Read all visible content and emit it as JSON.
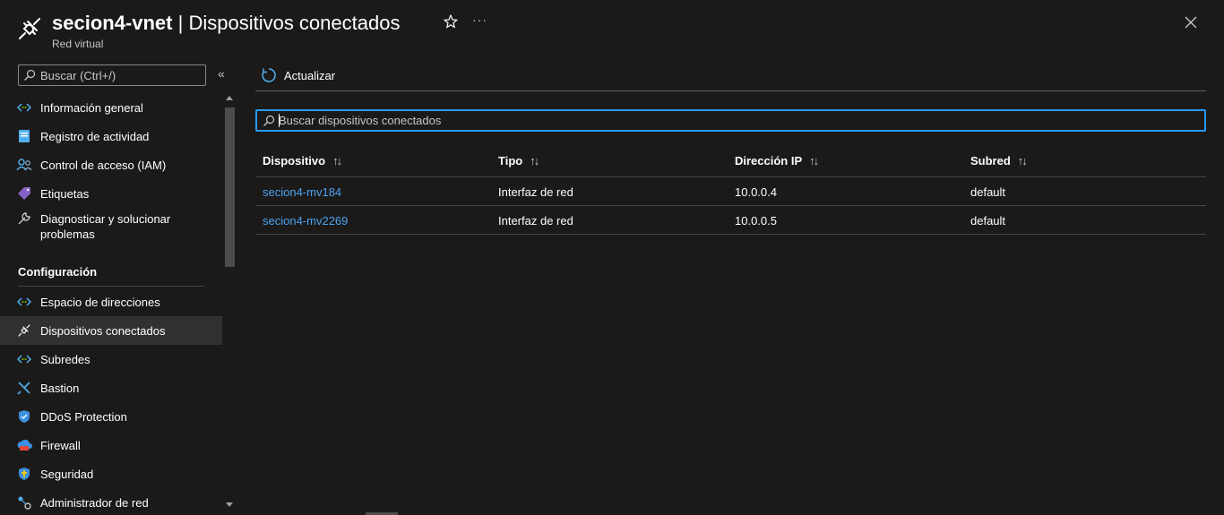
{
  "header": {
    "resource_name": "secion4-vnet",
    "separator": " | ",
    "page_title": "Dispositivos conectados",
    "subtitle": "Red virtual",
    "more_label": "···"
  },
  "sidebar": {
    "search_placeholder": "Buscar (Ctrl+/)",
    "collapse_label": "«",
    "items_top": [
      {
        "label": "Información general",
        "icon": "network-icon"
      },
      {
        "label": "Registro de actividad",
        "icon": "activity-log-icon"
      },
      {
        "label": "Control de acceso (IAM)",
        "icon": "iam-icon"
      },
      {
        "label": "Etiquetas",
        "icon": "tag-icon"
      },
      {
        "label": "Diagnosticar y solucionar problemas",
        "icon": "wrench-icon"
      }
    ],
    "section_configuracion": "Configuración",
    "items_config": [
      {
        "label": "Espacio de direcciones",
        "icon": "network-icon"
      },
      {
        "label": "Dispositivos conectados",
        "icon": "plug-icon",
        "active": true
      },
      {
        "label": "Subredes",
        "icon": "network-icon"
      },
      {
        "label": "Bastion",
        "icon": "bastion-icon"
      },
      {
        "label": "DDoS Protection",
        "icon": "shield-icon"
      },
      {
        "label": "Firewall",
        "icon": "firewall-icon"
      },
      {
        "label": "Seguridad",
        "icon": "security-shield-icon"
      },
      {
        "label": "Administrador de red",
        "icon": "network-manager-icon"
      }
    ]
  },
  "toolbar": {
    "refresh_label": "Actualizar"
  },
  "search": {
    "placeholder": "Buscar dispositivos conectados"
  },
  "table": {
    "columns": [
      "Dispositivo",
      "Tipo",
      "Dirección IP",
      "Subred"
    ],
    "sort_glyph": "↑↓",
    "rows": [
      {
        "device": "secion4-mv184",
        "type": "Interfaz de red",
        "ip": "10.0.0.4",
        "subnet": "default"
      },
      {
        "device": "secion4-mv2269",
        "type": "Interfaz de red",
        "ip": "10.0.0.5",
        "subnet": "default"
      }
    ]
  },
  "colors": {
    "background": "#1b1a19",
    "accent": "#2899f5",
    "link": "#4ca2f0",
    "active_item": "#323130"
  }
}
